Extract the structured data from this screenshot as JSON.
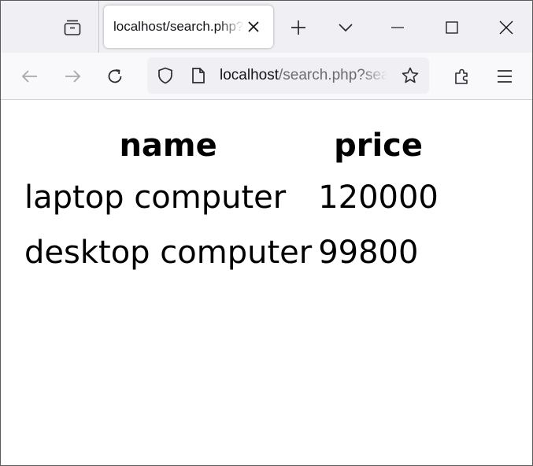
{
  "browser": {
    "tab": {
      "title": "localhost/search.php?search=computer"
    },
    "address_bar": {
      "host": "localhost",
      "path": "/search.php?search=computer"
    },
    "icons": [
      "tab-list-icon",
      "close-icon",
      "new-tab-plus-icon",
      "tabs-dropdown-chevron-icon",
      "minimize-icon",
      "maximize-icon",
      "window-close-icon",
      "back-arrow-icon",
      "forward-arrow-icon",
      "reload-icon",
      "shield-icon",
      "page-icon",
      "star-icon",
      "extensions-icon",
      "menu-icon"
    ]
  },
  "page": {
    "table": {
      "headers": {
        "name": "name",
        "price": "price"
      },
      "rows": [
        {
          "name": "laptop computer",
          "price": "120000"
        },
        {
          "name": "desktop computer",
          "price": "99800"
        }
      ]
    }
  }
}
